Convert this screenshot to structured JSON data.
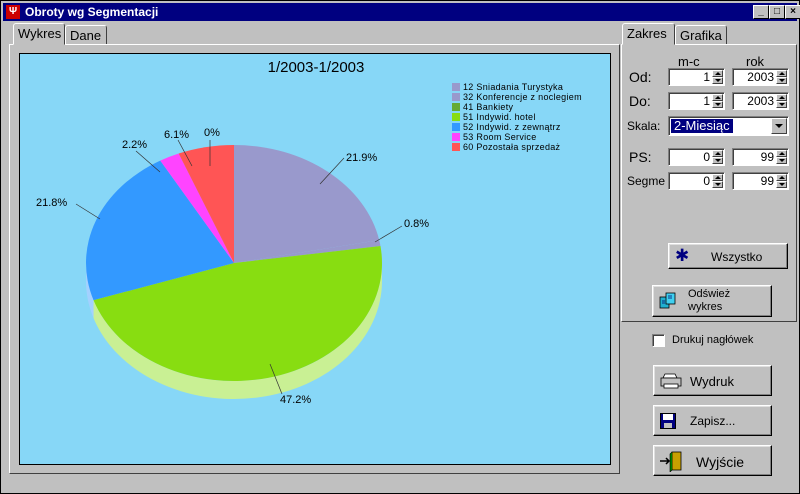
{
  "window": {
    "title": "Obroty wg Segmentacji",
    "app_icon": "app-icon",
    "min_label": "_",
    "max_label": "□",
    "close_label": "×"
  },
  "tabs_left": [
    {
      "label": "Wykres",
      "active": true
    },
    {
      "label": "Dane",
      "active": false
    }
  ],
  "tabs_right": [
    {
      "label": "Zakres",
      "active": true
    },
    {
      "label": "Grafika",
      "active": false
    }
  ],
  "chart_data": {
    "type": "pie",
    "title": "1/2003-1/2003",
    "background": "#87d7f7",
    "legend_position": "top-right",
    "series": [
      {
        "name": "12 Sniadania Turystyka",
        "value": 21.9,
        "label": "21.9%",
        "color": "#9999cc"
      },
      {
        "name": "32 Konferencje z noclegiem",
        "value": 0.8,
        "label": "0.8%",
        "color": "#9999cc"
      },
      {
        "name": "41 Bankiety",
        "value": 0.0,
        "label": "",
        "color": "#66aa33"
      },
      {
        "name": "51 Indywid. hotel",
        "value": 47.2,
        "label": "47.2%",
        "color": "#88dd11"
      },
      {
        "name": "52 Indywid. z zewnątrz",
        "value": 21.8,
        "label": "21.8%",
        "color": "#3399ff"
      },
      {
        "name": "53 Room Service",
        "value": 2.2,
        "label": "2.2%",
        "color": "#ff44ff"
      },
      {
        "name": "60 Pozostała sprzedaż",
        "value": 6.1,
        "label": "6.1%",
        "color": "#ff5555"
      }
    ],
    "extra_labels": [
      "0%"
    ]
  },
  "legend_items": [
    {
      "text": "12 Sniadania Turystyka",
      "color": "#9999cc"
    },
    {
      "text": "32 Konferencje z noclegiem",
      "color": "#9999cc"
    },
    {
      "text": "41 Bankiety",
      "color": "#66aa33"
    },
    {
      "text": "51 Indywid. hotel",
      "color": "#88dd11"
    },
    {
      "text": "52 Indywid. z zewnątrz",
      "color": "#3399ff"
    },
    {
      "text": "53 Room Service",
      "color": "#ff44ff"
    },
    {
      "text": "60 Pozostała sprzedaż",
      "color": "#ff5555"
    }
  ],
  "range": {
    "col_month": "m-c",
    "col_year": "rok",
    "from_label": "Od:",
    "from_month": "1",
    "from_year": "2003",
    "to_label": "Do:",
    "to_month": "1",
    "to_year": "2003",
    "scale_label": "Skala:",
    "scale_value": "2-Miesiąc",
    "ps_label": "PS:",
    "ps_from": "0",
    "ps_to": "99",
    "segme_label": "Segme",
    "segme_from": "0",
    "segme_to": "99",
    "all_button": "Wszystko",
    "refresh_button_line1": "Odśwież",
    "refresh_button_line2": "wykres"
  },
  "print_header_label": "Drukuj nagłówek",
  "print_header_checked": false,
  "buttons": {
    "print": "Wydruk",
    "save": "Zapisz...",
    "exit": "Wyjście"
  }
}
